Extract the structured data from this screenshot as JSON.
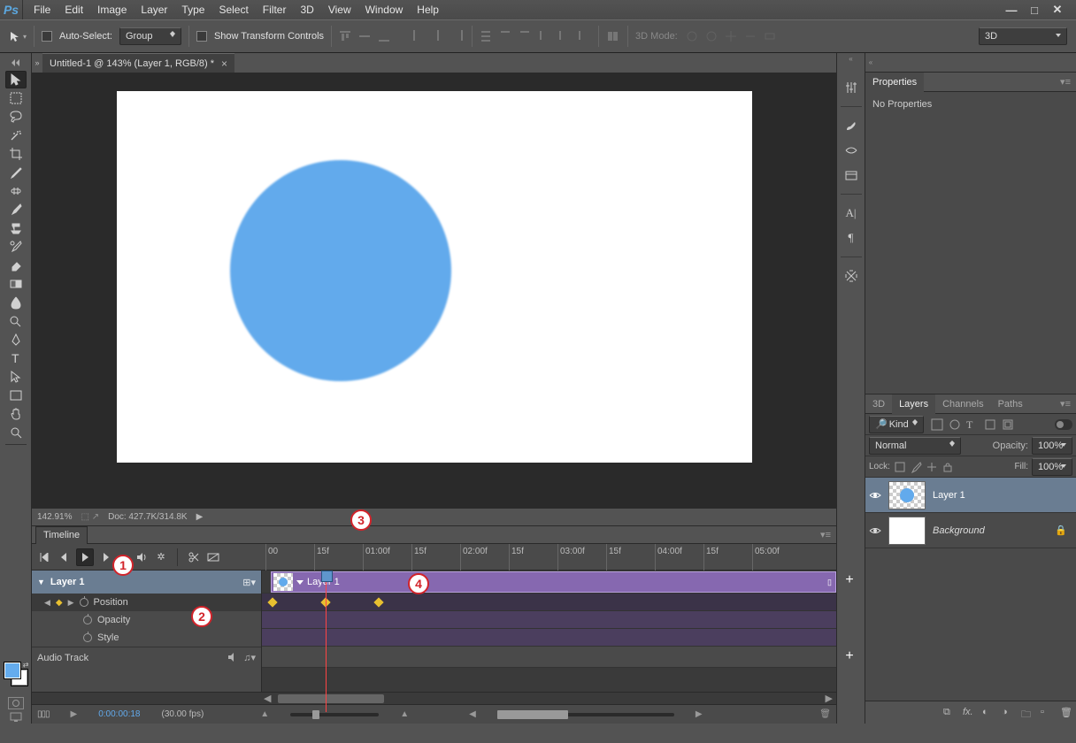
{
  "app_name": "Ps",
  "menu": [
    "File",
    "Edit",
    "Image",
    "Layer",
    "Type",
    "Select",
    "Filter",
    "3D",
    "View",
    "Window",
    "Help"
  ],
  "options_bar": {
    "auto_select": "Auto-Select:",
    "group": "Group",
    "show_transform": "Show Transform Controls",
    "mode_label": "3D Mode:",
    "mode_select": "3D"
  },
  "document": {
    "tab_title": "Untitled-1 @ 143% (Layer 1, RGB/8) *",
    "zoom": "142.91%",
    "doc_info": "Doc: 427.7K/314.8K"
  },
  "timeline": {
    "panel_name": "Timeline",
    "ticks": [
      "00",
      "15f",
      "01:00f",
      "15f",
      "02:00f",
      "15f",
      "03:00f",
      "15f",
      "04:00f",
      "15f",
      "05:00f"
    ],
    "layer_name": "Layer 1",
    "clip_label": "Layer 1",
    "properties": [
      "Position",
      "Opacity",
      "Style"
    ],
    "audio": "Audio Track",
    "timecode": "0:00:00:18",
    "fps": "(30.00 fps)"
  },
  "properties_panel": {
    "title": "Properties",
    "body": "No Properties"
  },
  "layers_panel": {
    "tabs": [
      "3D",
      "Layers",
      "Channels",
      "Paths"
    ],
    "kind": "Kind",
    "blend": "Normal",
    "opacity_lbl": "Opacity:",
    "opacity_val": "100%",
    "lock_lbl": "Lock:",
    "fill_lbl": "Fill:",
    "fill_val": "100%",
    "entries": [
      {
        "name": "Layer 1",
        "locked": false
      },
      {
        "name": "Background",
        "locked": true
      }
    ]
  },
  "callouts": [
    "1",
    "2",
    "3",
    "4"
  ]
}
